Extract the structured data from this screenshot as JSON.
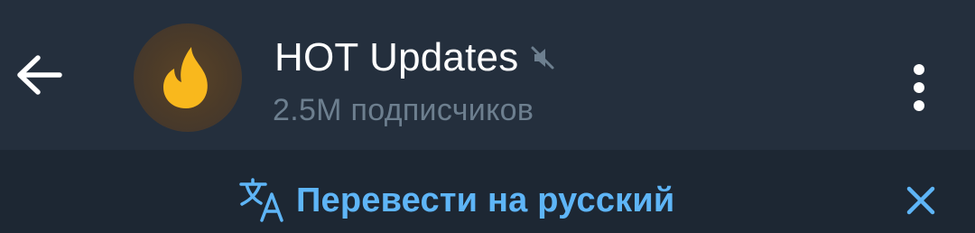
{
  "header": {
    "back_icon": "arrow-left-icon",
    "avatar_icon": "fire-emoji-icon",
    "title": "HOT Updates",
    "mute_icon": "muted-speaker-icon",
    "subtitle": "2.5M подписчиков",
    "menu_icon": "more-vertical-icon"
  },
  "translate_bar": {
    "icon": "translate-icon",
    "label": "Перевести на русский",
    "close_icon": "close-icon"
  },
  "colors": {
    "header_bg": "#242f3d",
    "translate_bar_bg": "#1d2733",
    "accent": "#5eb5f7",
    "subtitle": "#6d7f8f",
    "title": "#ffffff",
    "fire": "#f9b81d"
  }
}
